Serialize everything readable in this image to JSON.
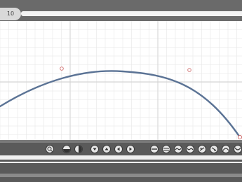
{
  "header": {
    "badge": "10"
  },
  "canvas": {
    "curve_color": "#5b7395",
    "point_color": "#d07070",
    "grid_color": "#e6e6e6"
  },
  "toolbar": {
    "tools": [
      {
        "name": "search-icon"
      },
      {
        "name": "half-fill-bottom-icon"
      },
      {
        "name": "half-fill-right-icon"
      },
      {
        "name": "triangle-down-icon"
      },
      {
        "name": "triangle-up-icon"
      },
      {
        "name": "triangle-left-icon"
      },
      {
        "name": "triangle-right-icon"
      },
      {
        "name": "line-style-icon-1"
      },
      {
        "name": "line-style-icon-2"
      },
      {
        "name": "line-style-icon-3"
      },
      {
        "name": "line-style-icon-4"
      },
      {
        "name": "line-style-icon-5"
      },
      {
        "name": "line-style-icon-6"
      },
      {
        "name": "line-style-icon-7"
      },
      {
        "name": "line-style-icon-8"
      }
    ]
  }
}
